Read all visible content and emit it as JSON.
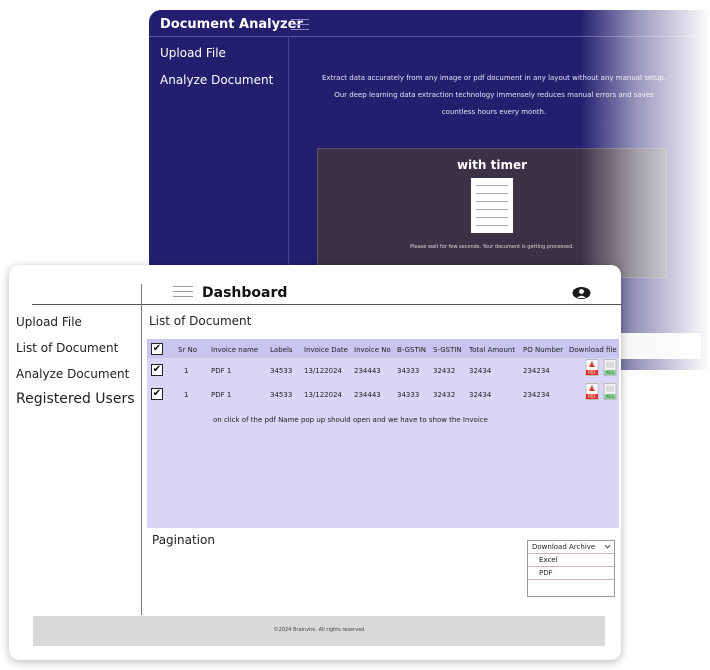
{
  "back_window": {
    "title": "Document Analyzer",
    "nav": [
      "Upload File",
      "Analyze Document"
    ],
    "description_lines": [
      "Extract data accurately from any image or pdf document in any layout without any manual setup.",
      "Our deep learning data extraction technology immensely reduces manual errors and saves",
      "countless hours every month."
    ],
    "timer_title": "with timer",
    "wait_message": "Please wait for few seconds. Your document is getting processed.",
    "bg_color": "#231e6e"
  },
  "front_window": {
    "title": "Dashboard",
    "nav": [
      "Upload File",
      "List of Document",
      "Analyze Document",
      "Registered Users"
    ],
    "section_title": "List of Document",
    "table": {
      "headers": [
        "Sr No",
        "Invoice name",
        "Labels",
        "Invoice Date",
        "Invoice No",
        "B-GSTIN",
        "S-GSTIN",
        "Total Amount",
        "PO Number",
        "Download file"
      ],
      "rows": [
        [
          "1",
          "PDF 1",
          "34533",
          "13/122024",
          "234443",
          "34333",
          "32432",
          "32434",
          "234234"
        ],
        [
          "1",
          "PDF 1",
          "34533",
          "13/122024",
          "234443",
          "34333",
          "32432",
          "32434",
          "234234"
        ]
      ],
      "row_icons": [
        "pdf-icon",
        "excel-icon"
      ],
      "icon_labels": {
        "pdf": "PDF",
        "excel": "XLS"
      },
      "note": "on click of the pdf Name pop up should open and we have to show the Invoice",
      "panel_color": "#d9d6f6"
    },
    "pagination_label": "Pagination",
    "download_archive": {
      "label": "Download Archive",
      "options": [
        "Excel",
        "PDF"
      ]
    },
    "footer": "©2024 Brainvire. All rights reserved"
  }
}
